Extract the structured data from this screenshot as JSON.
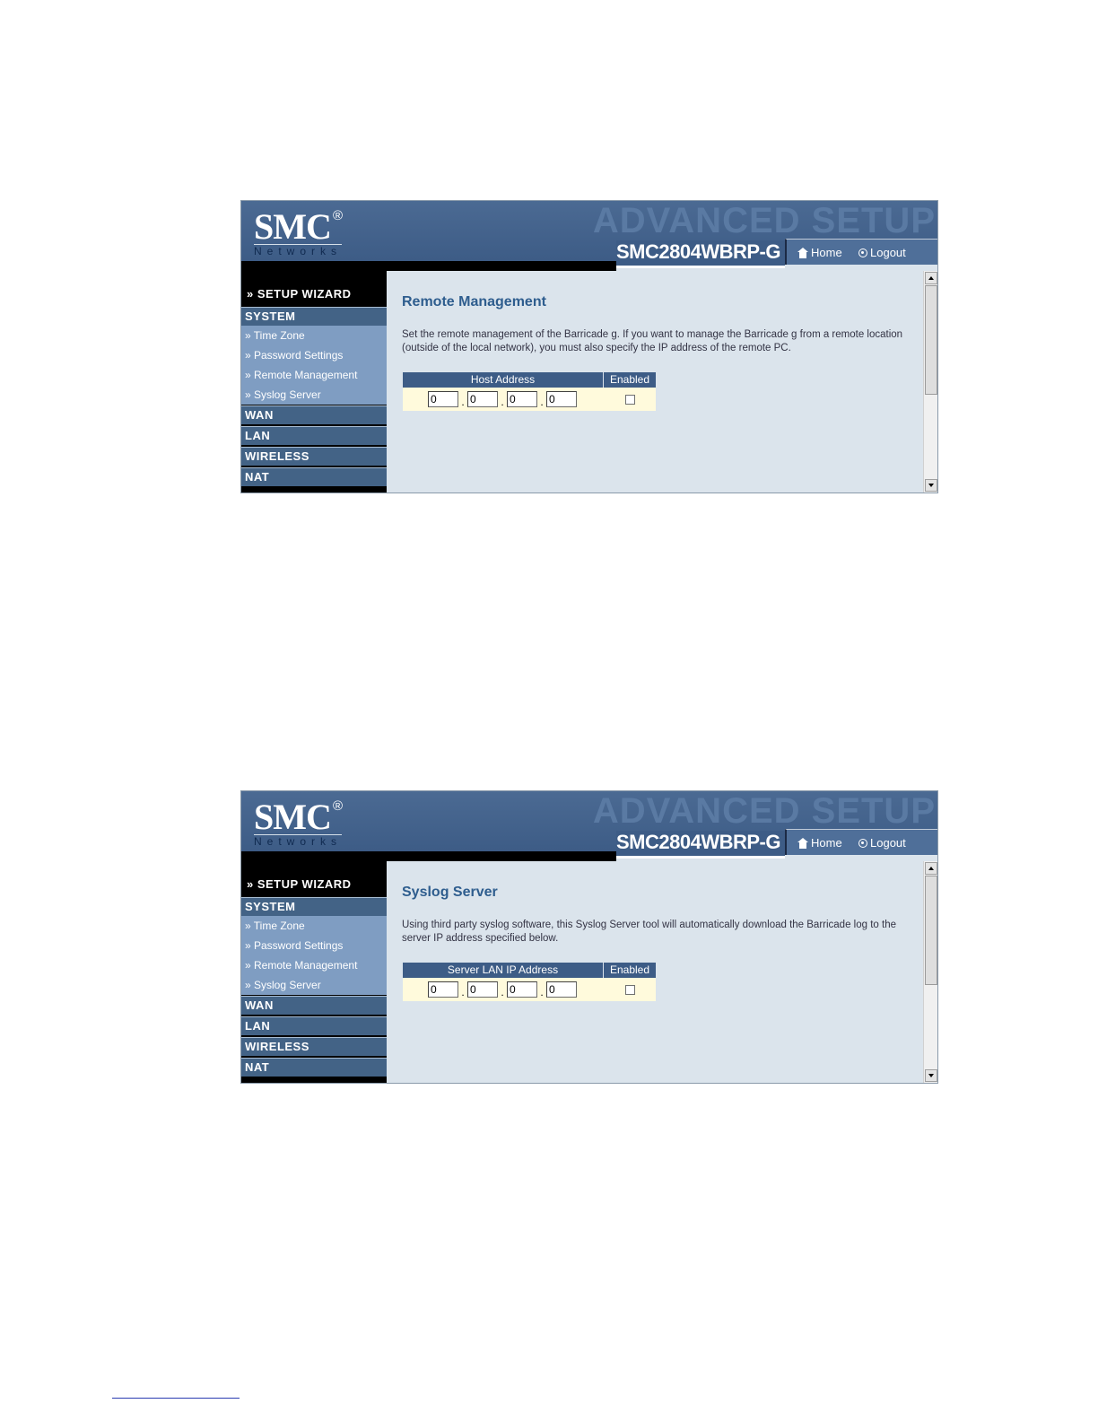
{
  "banner": {
    "logo_text": "SMC",
    "logo_reg": "®",
    "logo_sub": "Networks",
    "section_title": "ADVANCED SETUP",
    "model": "SMC2804WBRP-G",
    "home_label": "Home",
    "logout_label": "Logout"
  },
  "sidebar": {
    "wizard_label": "» SETUP WIZARD",
    "system_label": "SYSTEM",
    "system_items": [
      "» Time Zone",
      "» Password Settings",
      "» Remote Management",
      "» Syslog Server"
    ],
    "wan_label": "WAN",
    "lan_label": "LAN",
    "wireless_label": "WIRELESS",
    "nat_label": "NAT"
  },
  "screens": [
    {
      "title": "Remote Management",
      "description": "Set the remote management of the Barricade g. If you want to manage the Barricade g from a remote location (outside of the local network), you must also specify the IP address of the remote PC.",
      "col_address": "Host Address",
      "col_enabled": "Enabled",
      "octets": [
        "0",
        "0",
        "0",
        "0"
      ],
      "enabled": false
    },
    {
      "title": "Syslog Server",
      "description": "Using third party syslog software, this Syslog Server tool will automatically download the Barricade log to the server IP address specified below.",
      "col_address": "Server LAN IP Address",
      "col_enabled": "Enabled",
      "octets": [
        "0",
        "0",
        "0",
        "0"
      ],
      "enabled": false
    }
  ]
}
